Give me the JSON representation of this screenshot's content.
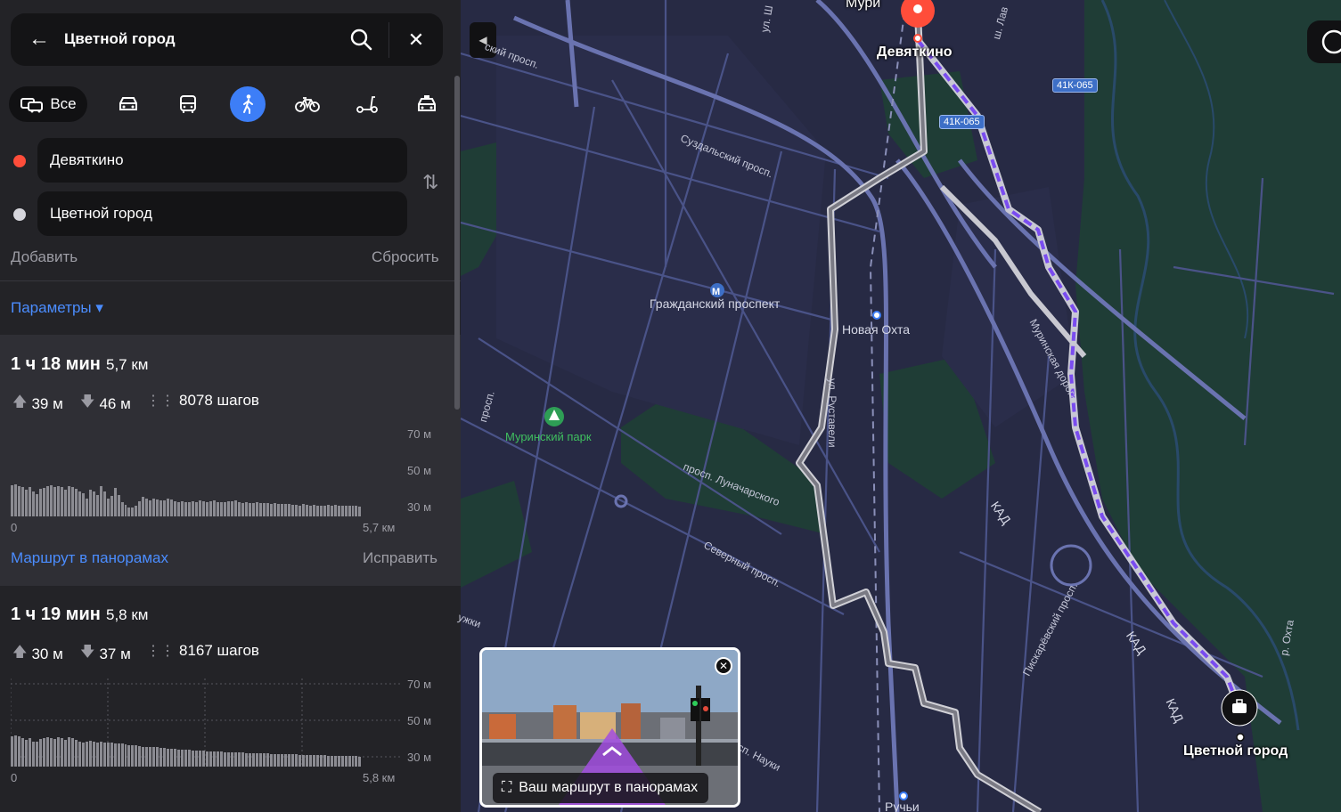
{
  "search": {
    "query": "Цветной город"
  },
  "modes": {
    "all_label": "Все"
  },
  "points": {
    "from": "Девяткино",
    "to": "Цветной город"
  },
  "actions": {
    "add": "Добавить",
    "reset": "Сбросить",
    "params": "Параметры ▾"
  },
  "routes": [
    {
      "time": "1 ч 18 мин",
      "distance": "5,7 км",
      "ascent": "39 м",
      "descent": "46 м",
      "steps": "8078 шагов",
      "elev_labels": [
        "70 м",
        "50 м",
        "30 м"
      ],
      "axis_start": "0",
      "axis_end": "5,7 км",
      "elevation_profile": [
        35,
        36,
        34,
        33,
        30,
        33,
        28,
        25,
        31,
        32,
        34,
        35,
        33,
        34,
        33,
        30,
        34,
        33,
        31,
        28,
        26,
        20,
        30,
        28,
        24,
        34,
        28,
        20,
        23,
        32,
        24,
        16,
        13,
        10,
        10,
        12,
        17,
        22,
        20,
        18,
        20,
        19,
        18,
        18,
        20,
        19,
        17,
        16,
        17,
        16,
        16,
        17,
        16,
        18,
        17,
        16,
        17,
        18,
        16,
        16,
        16,
        17,
        17,
        18,
        16,
        15,
        16,
        15,
        15,
        16,
        15,
        15,
        15,
        14,
        15,
        14,
        14,
        14,
        14,
        13,
        13,
        12,
        14,
        13,
        12,
        13,
        12,
        12,
        12,
        13,
        12,
        13,
        12,
        12,
        12,
        12,
        12,
        12,
        11
      ],
      "panorama_link": "Маршрут в панорамах",
      "fix_link": "Исправить"
    },
    {
      "time": "1 ч 19 мин",
      "distance": "5,8 км",
      "ascent": "30 м",
      "descent": "37 м",
      "steps": "8167 шагов",
      "elev_labels": [
        "70 м",
        "50 м",
        "30 м"
      ],
      "axis_start": "0",
      "axis_end": "5,8 км",
      "elevation_profile": [
        34,
        35,
        34,
        32,
        30,
        32,
        28,
        28,
        31,
        32,
        33,
        32,
        31,
        33,
        32,
        30,
        33,
        32,
        30,
        28,
        27,
        28,
        29,
        28,
        27,
        28,
        27,
        27,
        27,
        26,
        26,
        26,
        25,
        24,
        24,
        24,
        23,
        22,
        22,
        22,
        22,
        22,
        21,
        21,
        20,
        20,
        20,
        19,
        19,
        19,
        19,
        18,
        18,
        18,
        18,
        17,
        17,
        17,
        17,
        17,
        16,
        16,
        16,
        16,
        16,
        16,
        15,
        15,
        15,
        15,
        15,
        15,
        15,
        14,
        14,
        14,
        14,
        14,
        14,
        14,
        14,
        13,
        13,
        13,
        13,
        13,
        13,
        13,
        13,
        12,
        12,
        12,
        12,
        12,
        12,
        12,
        12,
        12,
        11
      ]
    }
  ],
  "map": {
    "labels": {
      "murino": "Мури",
      "devyatkino": "Девяткино",
      "grazhdansky": "Гражданский проспект",
      "novaya_okhta": "Новая Охта",
      "murinsky_park": "Муринский парк",
      "suzdalsky": "Суздальский просп.",
      "rustaveli": "ул. Руставели",
      "lunacharskogo": "просп. Луначарского",
      "severny": "Северный просп.",
      "kad1": "КАД",
      "kad2": "КАД",
      "kad3": "КАД",
      "murinskaya_doroga": "Муринская дорога",
      "piskarevsky": "Пискарёвский просп.",
      "nauki": "сп. Науки",
      "ruchyi": "Ручьи",
      "okhta": "р. Охта",
      "tsvetnoy": "Цветной город",
      "shield1": "41К-065",
      "shield2": "41К-065",
      "left1": "просп.",
      "left2": "ский просп.",
      "left3": "ужки",
      "ul_top": "ул. Ш",
      "sh_top": "ш. Лав"
    },
    "panorama_label": "Ваш маршрут в панорамах",
    "colors": {
      "route_primary": "#7a4cf0",
      "route_alt": "#b4b4bc",
      "destination_marker": "#ff4d3a",
      "active_mode": "#3d7ef7"
    }
  }
}
